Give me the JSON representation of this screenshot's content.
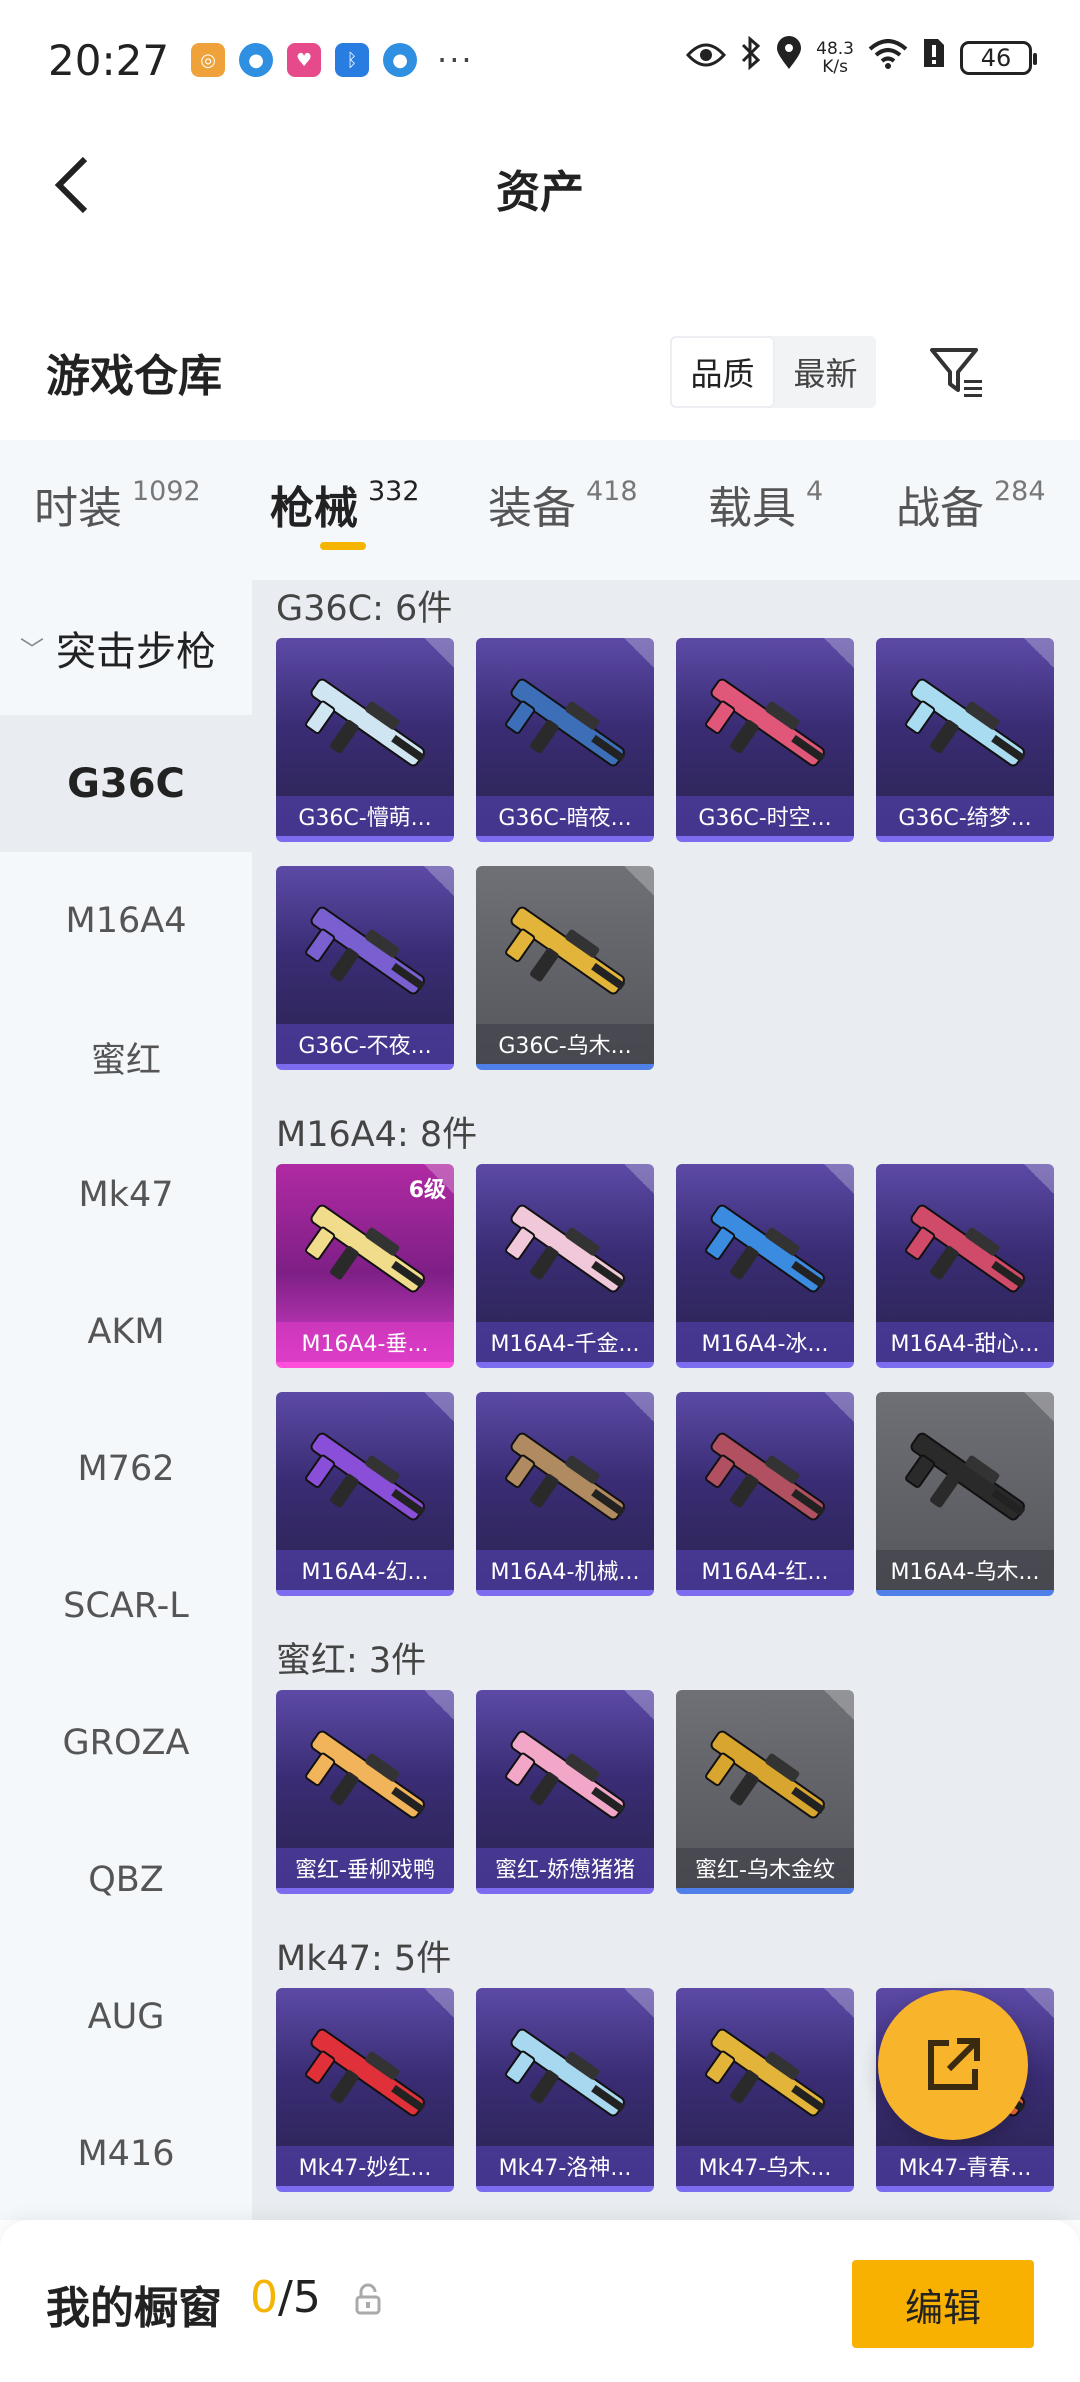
{
  "status_bar": {
    "time": "20:27",
    "net_speed_value": "48.3",
    "net_speed_unit": "K/s",
    "battery": "46",
    "more": "···"
  },
  "header": {
    "title": "资产"
  },
  "warehouse": {
    "title": "游戏仓库",
    "sort_options": [
      "品质",
      "最新"
    ],
    "sort_selected": "品质"
  },
  "tabs": [
    {
      "label": "时装",
      "count": "1092"
    },
    {
      "label": "枪械",
      "count": "332"
    },
    {
      "label": "装备",
      "count": "418"
    },
    {
      "label": "载具",
      "count": "4"
    },
    {
      "label": "战备",
      "count": "284"
    }
  ],
  "active_tab": "枪械",
  "sidebar": {
    "category": "突击步枪",
    "items": [
      "G36C",
      "M16A4",
      "蜜红",
      "Mk47",
      "AKM",
      "M762",
      "SCAR-L",
      "GROZA",
      "QBZ",
      "AUG",
      "M416"
    ],
    "active": "G36C"
  },
  "groups": [
    {
      "title": "G36C: 6件",
      "items": [
        {
          "name": "G36C-懵萌...",
          "style": "purple",
          "gun_color": "#cfe6f2"
        },
        {
          "name": "G36C-暗夜...",
          "style": "purple",
          "gun_color": "#3d6fb8"
        },
        {
          "name": "G36C-时空...",
          "style": "purple",
          "gun_color": "#e0577a"
        },
        {
          "name": "G36C-绮梦...",
          "style": "purple",
          "gun_color": "#a9dcf0"
        },
        {
          "name": "G36C-不夜...",
          "style": "purple",
          "gun_color": "#7a5fd0"
        },
        {
          "name": "G36C-乌木...",
          "style": "gray",
          "gun_color": "#e2b43a"
        }
      ]
    },
    {
      "title": "M16A4: 8件",
      "items": [
        {
          "name": "M16A4-垂...",
          "style": "pink",
          "gun_color": "#f0dc8a",
          "badge": "6级"
        },
        {
          "name": "M16A4-千金...",
          "style": "purple",
          "gun_color": "#f0c8da"
        },
        {
          "name": "M16A4-冰...",
          "style": "purple",
          "gun_color": "#3b8be0"
        },
        {
          "name": "M16A4-甜心...",
          "style": "purple",
          "gun_color": "#d04a6a"
        },
        {
          "name": "M16A4-幻...",
          "style": "purple",
          "gun_color": "#8a4fd8"
        },
        {
          "name": "M16A4-机械...",
          "style": "purple",
          "gun_color": "#b08a60"
        },
        {
          "name": "M16A4-红...",
          "style": "purple",
          "gun_color": "#b05060"
        },
        {
          "name": "M16A4-乌木...",
          "style": "gray",
          "gun_color": "#2a2a2a"
        }
      ]
    },
    {
      "title": "蜜红: 3件",
      "items": [
        {
          "name": "蜜红-垂柳戏鸭",
          "style": "purple",
          "gun_color": "#f2b45a"
        },
        {
          "name": "蜜红-娇憊猪猪",
          "style": "purple",
          "gun_color": "#f2a6c8"
        },
        {
          "name": "蜜红-乌木金纹",
          "style": "gray",
          "gun_color": "#d8a52e"
        }
      ]
    },
    {
      "title": "Mk47: 5件",
      "items": [
        {
          "name": "Mk47-妙红...",
          "style": "purple",
          "gun_color": "#e0303a"
        },
        {
          "name": "Mk47-洛神...",
          "style": "purple",
          "gun_color": "#a8d8f0"
        },
        {
          "name": "Mk47-乌木...",
          "style": "purple",
          "gun_color": "#e2b43a"
        },
        {
          "name": "Mk47-青春...",
          "style": "purple",
          "gun_color": "#f06a40"
        }
      ]
    }
  ],
  "bottom_bar": {
    "label": "我的橱窗",
    "current": "0",
    "total": "/5",
    "edit_label": "编辑"
  },
  "colors": {
    "accent": "#f5b400",
    "card_purple": "#3a2c74",
    "card_gray": "#5f6066",
    "card_pink": "#b02aa3"
  }
}
